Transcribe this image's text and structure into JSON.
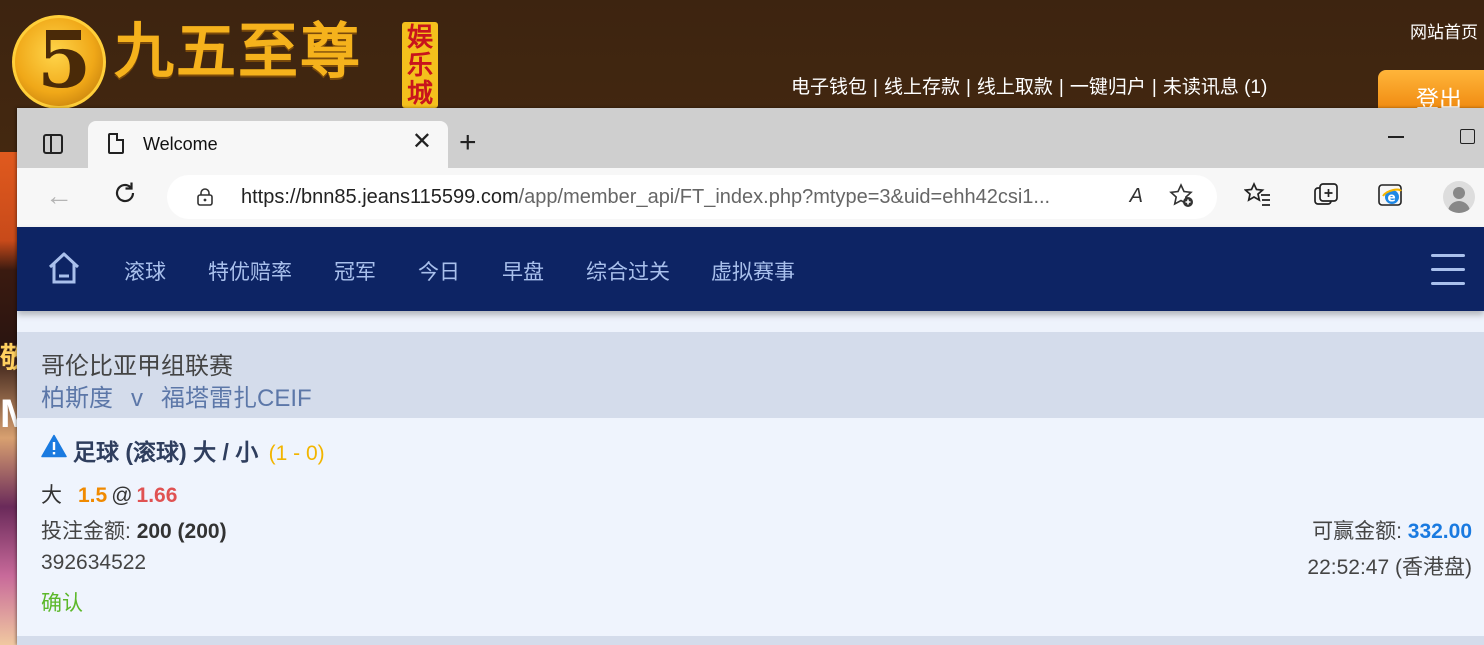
{
  "background_site": {
    "logo_digit": "5",
    "logo_text": "九五至尊",
    "logo_tag": "娱乐城",
    "home_link": "网站首页",
    "nav": [
      "电子钱包",
      "线上存款",
      "线上取款",
      "一键归户",
      "未读讯息 (1)"
    ],
    "nav_separator": "|",
    "logout": "登出",
    "strip_chars": [
      "敬",
      "M"
    ]
  },
  "browser": {
    "tab_title": "Welcome",
    "url_host": "https://bnn85.jeans115599.com",
    "url_path": "/app/member_api/FT_index.php?mtype=3&uid=ehh42csi1...",
    "read_aloud_glyph": "A",
    "close_glyph": "✕",
    "new_tab_glyph": "+",
    "back_glyph": "←"
  },
  "nav": {
    "items": [
      "滚球",
      "特优赔率",
      "冠军",
      "今日",
      "早盘",
      "综合过关",
      "虚拟赛事"
    ]
  },
  "league": {
    "name": "哥伦比亚甲组联赛",
    "home_team": "柏斯度",
    "vs": "v",
    "away_team": "福塔雷扎CEIF"
  },
  "bet": {
    "title": "足球 (滚球) 大 / 小",
    "score": "(1 - 0)",
    "pick_label": "大",
    "pick_line": "1.5",
    "pick_at": "@",
    "pick_odds": "1.66",
    "stake_label": "投注金额:",
    "stake_value": "200 (200)",
    "win_label": "可赢金额:",
    "win_value": "332.00",
    "ticket_no": "392634522",
    "time": "22:52:47 (香港盘)",
    "status": "确认"
  },
  "colors": {
    "nav_bg": "#0d2464",
    "nav_text": "#a9c0ec",
    "league_bg": "#d4dceb",
    "bet_bg": "#eff4fd",
    "score": "#f2b500",
    "line": "#f08a00",
    "odds": "#e05252",
    "win_value": "#1a7ae0",
    "status": "#5cb82a"
  }
}
